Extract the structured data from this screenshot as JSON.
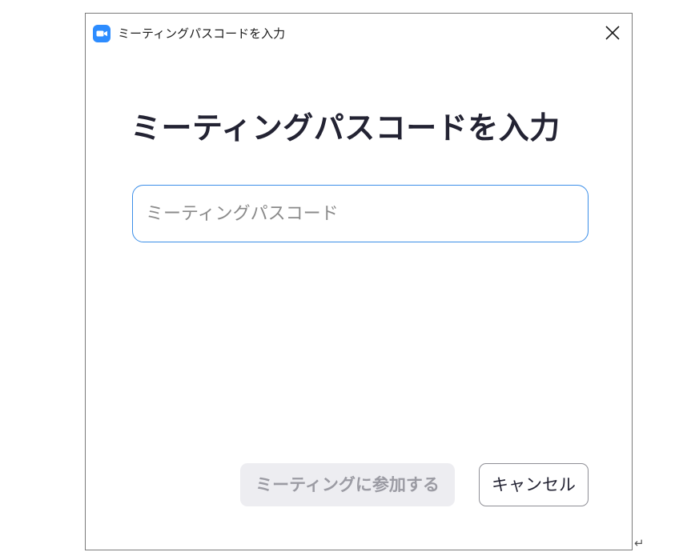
{
  "window": {
    "title": "ミーティングパスコードを入力",
    "app_icon": "zoom-camera-icon",
    "close_icon": "close-icon"
  },
  "dialog": {
    "heading": "ミーティングパスコードを入力",
    "passcode_input": {
      "value": "",
      "placeholder": "ミーティングパスコード"
    },
    "join_button_label": "ミーティングに参加する",
    "join_button_enabled": false,
    "cancel_button_label": "キャンセル"
  },
  "document": {
    "paragraph_mark": "↵"
  },
  "colors": {
    "accent": "#2d8cff",
    "input_border": "#3b8ee8",
    "disabled_bg": "#ededf1",
    "disabled_text": "#9b9ba3",
    "heading_text": "#232333"
  }
}
